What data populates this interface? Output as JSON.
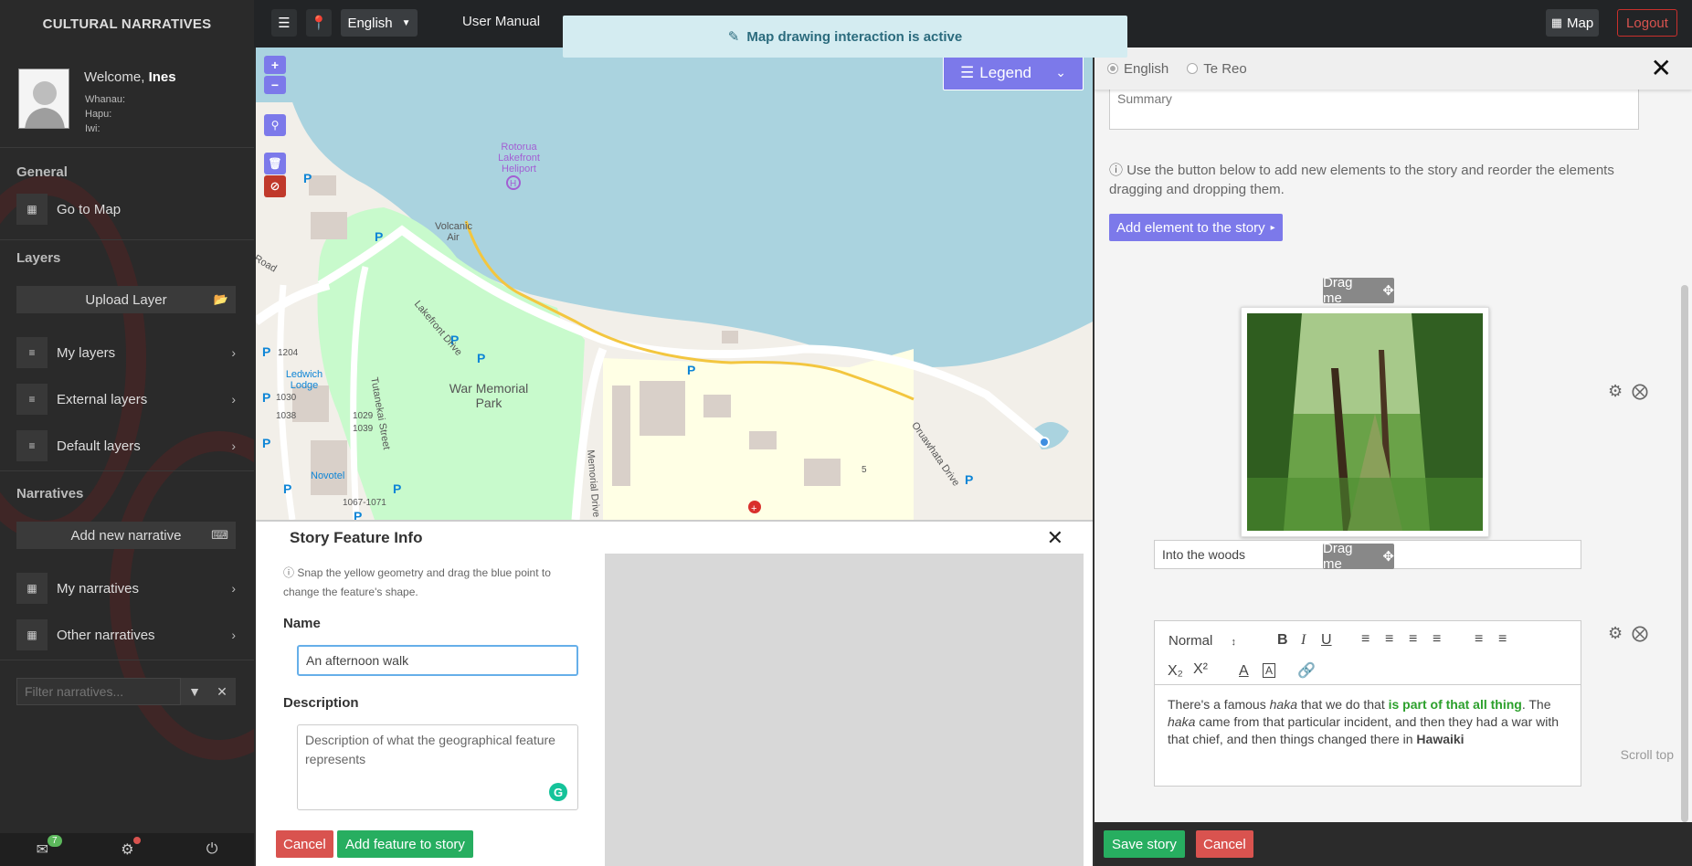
{
  "topbar": {
    "brand": "CULTURAL NARRATIVES",
    "language": "English",
    "user_manual": "User Manual",
    "map_label": "Map",
    "logout_label": "Logout"
  },
  "notification": {
    "text": "Map drawing interaction is active"
  },
  "sidebar": {
    "welcome_prefix": "Welcome,",
    "user_name": "Ines",
    "whanau_label": "Whanau:",
    "hapu_label": "Hapu:",
    "iwi_label": "Iwi:",
    "general_header": "General",
    "go_to_map": "Go to Map",
    "layers_header": "Layers",
    "upload_layer": "Upload Layer",
    "my_layers": "My layers",
    "external_layers": "External layers",
    "default_layers": "Default layers",
    "narratives_header": "Narratives",
    "add_new_narrative": "Add new narrative",
    "my_narratives": "My narratives",
    "other_narratives": "Other narratives",
    "filter_placeholder": "Filter narratives...",
    "message_count": "7"
  },
  "map": {
    "legend_label": "Legend",
    "zoom_in": "+",
    "zoom_out": "−",
    "labels": {
      "heliport": "Rotorua Lakefront Heliport",
      "volcanic_air": "Volcanic Air",
      "lakefront_drive": "Lakefront Drive",
      "war_memorial_park": "War Memorial Park",
      "tutanekai_street": "Tutanekai Street",
      "memorial_drive": "Memorial Drive",
      "oruawhata_drive": "Oruawhata Drive",
      "ledwich_lodge": "Ledwich Lodge",
      "novotel": "Novotel",
      "road": "Road",
      "n1204": "1204",
      "n1030": "1030",
      "n1038": "1038",
      "n1029": "1029",
      "n1039": "1039",
      "n1067": "1067-1071",
      "n5": "5"
    }
  },
  "story_feature": {
    "title": "Story Feature Info",
    "help": "Snap the yellow geometry and drag the blue point to change the feature's shape.",
    "name_label": "Name",
    "name_value": "An afternoon walk",
    "description_label": "Description",
    "description_placeholder": "Description of what the geographical feature represents",
    "cancel": "Cancel",
    "add_feature": "Add feature to story"
  },
  "story_editor": {
    "lang_english": "English",
    "lang_tereo": "Te Reo",
    "summary_placeholder": "Summary",
    "help": "Use the button below to add new elements to the story and reorder the elements dragging and dropping them.",
    "add_element": "Add element to the story",
    "drag_me": "Drag me",
    "image_caption": "Into the woods",
    "format_select": "Normal",
    "text_parts": {
      "p1": "There's a famous ",
      "haka1": "haka",
      "p2": " that we do that ",
      "bold_green": "is part of that all thing",
      "p3": ". The ",
      "haka2": "haka",
      "p4": " came from that particular incident, and then they had a war with that chief, and then things changed there in ",
      "hawaiki": "Hawaiki"
    },
    "scroll_top": "Scroll top",
    "save_story": "Save story",
    "cancel": "Cancel"
  }
}
